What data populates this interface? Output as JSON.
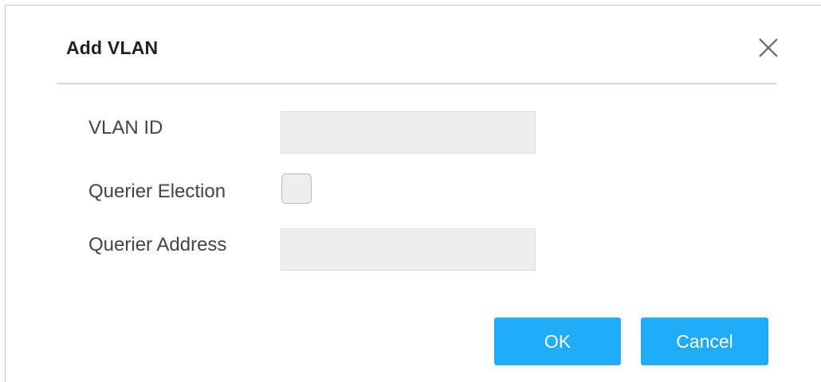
{
  "dialog": {
    "title": "Add VLAN",
    "close_icon": "close-icon"
  },
  "form": {
    "vlan_id_label": "VLAN ID",
    "vlan_id_value": "",
    "querier_election_label": "Querier Election",
    "querier_election_checked": false,
    "querier_address_label": "Querier Address",
    "querier_address_value": ""
  },
  "buttons": {
    "ok_label": "OK",
    "cancel_label": "Cancel"
  },
  "colors": {
    "accent": "#1fabf5",
    "input_bg": "#eeeeee",
    "divider": "#d6d6d6"
  }
}
